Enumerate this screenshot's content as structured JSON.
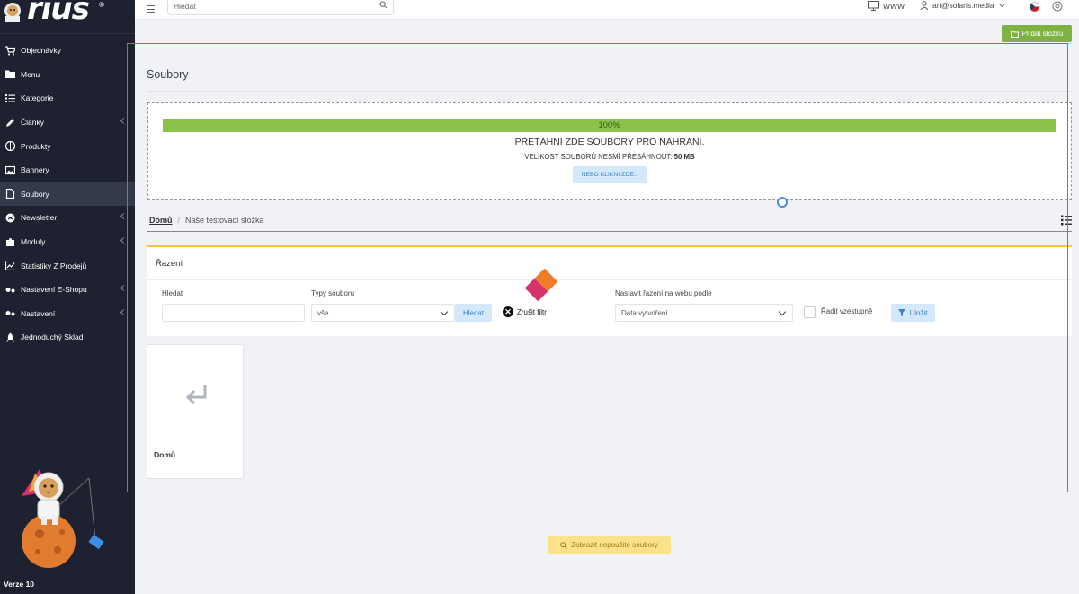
{
  "app": {
    "logo_text": "rius",
    "version": "Verze 10"
  },
  "sidebar": {
    "items": [
      {
        "label": "Objednávky",
        "icon": "cart-icon",
        "has_submenu": false,
        "active": false
      },
      {
        "label": "Menu",
        "icon": "folder-icon",
        "has_submenu": false,
        "active": false
      },
      {
        "label": "Kategorie",
        "icon": "list-icon",
        "has_submenu": false,
        "active": false
      },
      {
        "label": "Články",
        "icon": "pencil-icon",
        "has_submenu": true,
        "active": false
      },
      {
        "label": "Produkty",
        "icon": "product-icon",
        "has_submenu": false,
        "active": false
      },
      {
        "label": "Bannery",
        "icon": "image-icon",
        "has_submenu": false,
        "active": false
      },
      {
        "label": "Soubory",
        "icon": "file-icon",
        "has_submenu": false,
        "active": true
      },
      {
        "label": "Newsletter",
        "icon": "newsletter-icon",
        "has_submenu": true,
        "active": false
      },
      {
        "label": "Moduly",
        "icon": "puzzle-icon",
        "has_submenu": true,
        "active": false
      },
      {
        "label": "Statistiky Z Prodejů",
        "icon": "chart-icon",
        "has_submenu": false,
        "active": false
      },
      {
        "label": "Nastavení E-Shopu",
        "icon": "settings-icon",
        "has_submenu": true,
        "active": false
      },
      {
        "label": "Nastavení",
        "icon": "settings-icon",
        "has_submenu": true,
        "active": false
      },
      {
        "label": "Jednoduchý Sklad",
        "icon": "rocket-icon",
        "has_submenu": false,
        "active": false
      }
    ]
  },
  "topbar": {
    "search_placeholder": "Hledat",
    "www_label": "WWW",
    "user_email": "art@solaris.media"
  },
  "actions": {
    "add_folder": "Přidat složku"
  },
  "page": {
    "title": "Soubory"
  },
  "dropzone": {
    "progress": 100,
    "progress_label": "100%",
    "title": "PŘETÁHNI ZDE SOUBORY PRO NAHRÁNÍ.",
    "size_text": "VELIKOST SOUBORŮ NESMÍ PŘESÁHNOUT:",
    "size_value": "50 MB",
    "click_button": "NEBO KLIKNI ZDE..."
  },
  "breadcrumb": {
    "home": "Domů",
    "separator": "/",
    "current": "Naše testovací složka"
  },
  "sorting": {
    "title": "Řazení",
    "search_label": "Hledat",
    "search_value": "",
    "type_label": "Typy souboru",
    "type_value": "vše",
    "search_button": "Hledat",
    "clear_filter": "Zrušit filtr",
    "order_label": "Nastavit řazení na webu podle",
    "order_value": "Data vytvoření",
    "ascending_label": "Řadit vzestupně",
    "ascending_checked": false,
    "save_button": "Uložit"
  },
  "tiles": [
    {
      "label": "Domů",
      "icon": "return-arrow-icon"
    }
  ],
  "footer": {
    "unused_button": "Zobrazit nepoužité soubory"
  },
  "colors": {
    "sidebar_bg": "#1e2230",
    "accent_green": "#7cb342",
    "progress_green": "#8bc34a",
    "highlight_red": "#d9534f",
    "warning_yellow": "#fbe28a"
  }
}
